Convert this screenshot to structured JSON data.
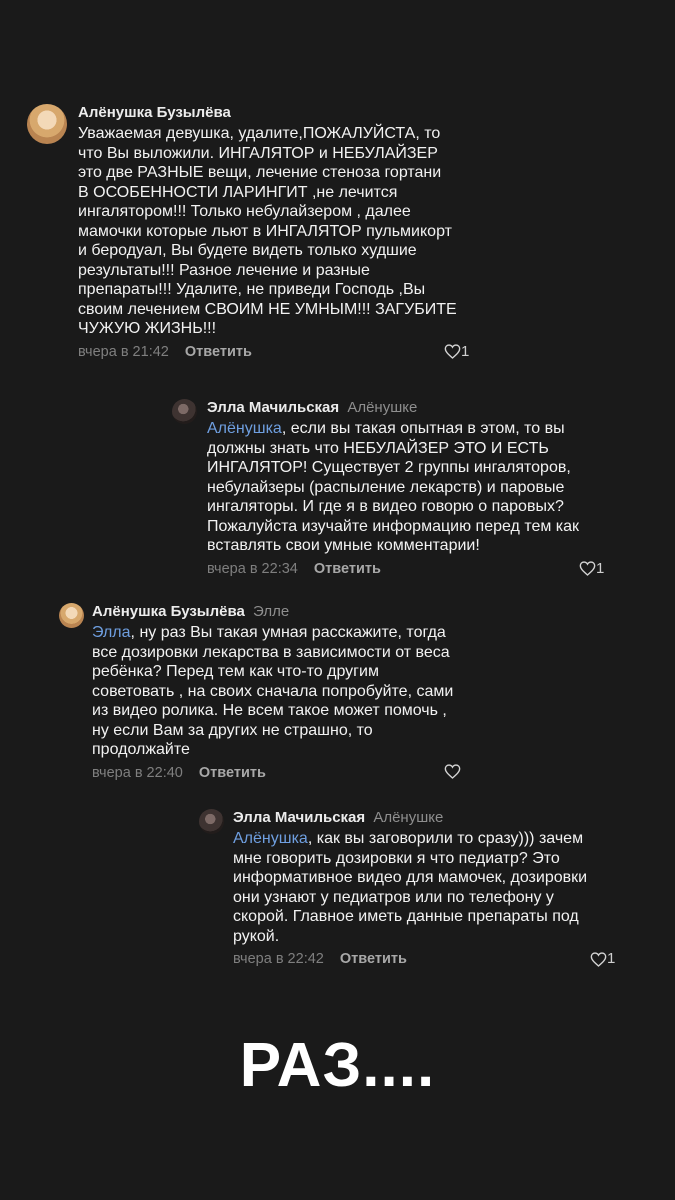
{
  "comments": [
    {
      "username": "Алёнушка Бузылёва",
      "reply_to": "",
      "mention": "",
      "text": "Уважаемая девушка,  удалите,ПОЖАЛУЙСТА,  то\nчто Вы выложили.  ИНГАЛЯТОР и НЕБУЛАЙЗЕР\nэто две РАЗНЫЕ вещи, лечение стеноза гортани\nВ ОСОБЕННОСТИ ЛАРИНГИТ ,не лечится\nингалятором!!! Только небулайзером , далее\nмамочки которые льют в ИНГАЛЯТОР пульмикорт\nи беродуал, Вы будете видеть только худшие\nрезультаты!!! Разное лечение и разные\nпрепараты!!! Удалите, не приведи Господь ,Вы\nсвоим лечением СВОИМ НЕ УМНЫМ!!! ЗАГУБИТЕ\nЧУЖУЮ ЖИЗНЬ!!!",
      "time": "вчера в 21:42",
      "reply_label": "Ответить",
      "likes": "1"
    },
    {
      "username": "Элла Мачильская",
      "reply_to": "Алёнушке",
      "mention": "Алёнушка",
      "text": ", если вы такая опытная в этом, то вы\nдолжны знать что НЕБУЛАЙЗЕР ЭТО И ЕСТЬ\nИНГАЛЯТОР! Существует 2 группы ингаляторов,\nнебулайзеры (распыление лекарств) и паровые\nингаляторы. И где я в видео говорю о паровых?\nПожалуйста изучайте информацию перед тем как\nвставлять свои умные комментарии!",
      "time": "вчера в 22:34",
      "reply_label": "Ответить",
      "likes": "1"
    },
    {
      "username": "Алёнушка Бузылёва",
      "reply_to": "Элле",
      "mention": "Элла",
      "text": ", ну раз Вы такая умная расскажите, тогда\nвсе дозировки лекарства в зависимости от веса\nребёнка? Перед тем как что-то другим\nсоветовать , на своих сначала попробуйте, сами\nиз видео ролика. Не всем такое может помочь ,\n ну если Вам за других не страшно,  то\nпродолжайте",
      "time": "вчера в 22:40",
      "reply_label": "Ответить",
      "likes": ""
    },
    {
      "username": "Элла Мачильская",
      "reply_to": "Алёнушке",
      "mention": "Алёнушка",
      "text": ", как вы заговорили то сразу))) зачем\nмне говорить дозировки я что педиатр? Это\nинформативное видео для мамочек, дозировки\nони узнают у педиатров или по телефону у\nскорой. Главное иметь данные препараты под\nрукой.",
      "time": "вчера в 22:42",
      "reply_label": "Ответить",
      "likes": "1"
    }
  ],
  "caption": "РАЗ....",
  "colors": {
    "background": "#1a1a1a",
    "mention": "#6f9fe0",
    "meta": "#7f7f7f"
  },
  "icons": [
    "heart-icon"
  ]
}
